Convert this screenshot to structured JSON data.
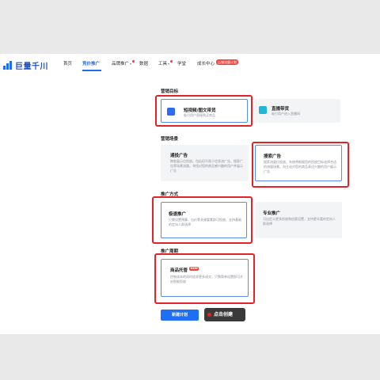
{
  "brand": {
    "name": "巨量千川"
  },
  "nav": {
    "items": [
      {
        "label": "首页"
      },
      {
        "label": "竞价推广"
      },
      {
        "label": "品牌推广"
      },
      {
        "label": "数据"
      },
      {
        "label": "工具"
      },
      {
        "label": "学堂"
      },
      {
        "label": "成长中心"
      }
    ],
    "badge": "店铺流量计划"
  },
  "sections": {
    "marketing_goal": "营销目标",
    "marketing_scene": "营销场景",
    "promo_method": "推广方式",
    "promo_period": "推广周期"
  },
  "cards": {
    "short_video": {
      "title": "短视频/图文带货",
      "desc": "吸引用户直接购买商品"
    },
    "live": {
      "title": "直播带货",
      "desc": "吸引用户进入直播间"
    },
    "general_ad": {
      "title": "通投广告",
      "desc": "跨各展示位投放。包括但不限于信息流广告、搜索广告等场景流量。寻找对您的商品感兴趣的用户并展示广告"
    },
    "search_ad": {
      "title": "搜索广告",
      "desc": "搜索流量位投放。系统将根据您的投放目标选择合适的流量场景。向主动对您的商品表达兴趣的用户展示广告"
    },
    "quick_promo": {
      "title": "极速推广",
      "desc": "只需设置预算、出价等关键要素即可投放，支持基础的定向人群选择"
    },
    "pro_promo": {
      "title": "专业推广",
      "desc": "可自定义更多投放和创意设置，支持更丰富的定向人群选择"
    },
    "product_hosting": {
      "title": "商品托管",
      "badge": "NEW",
      "desc": "控制成本的同时追求更多成交，只需简单设置即可开启智能投放"
    }
  },
  "actions": {
    "new_plan": "新建计划"
  },
  "annotation": {
    "callout": "点击创建"
  },
  "colors": {
    "primary": "#1f6ff5",
    "highlight": "#e0242a",
    "card_gray": "#f3f4f6"
  }
}
